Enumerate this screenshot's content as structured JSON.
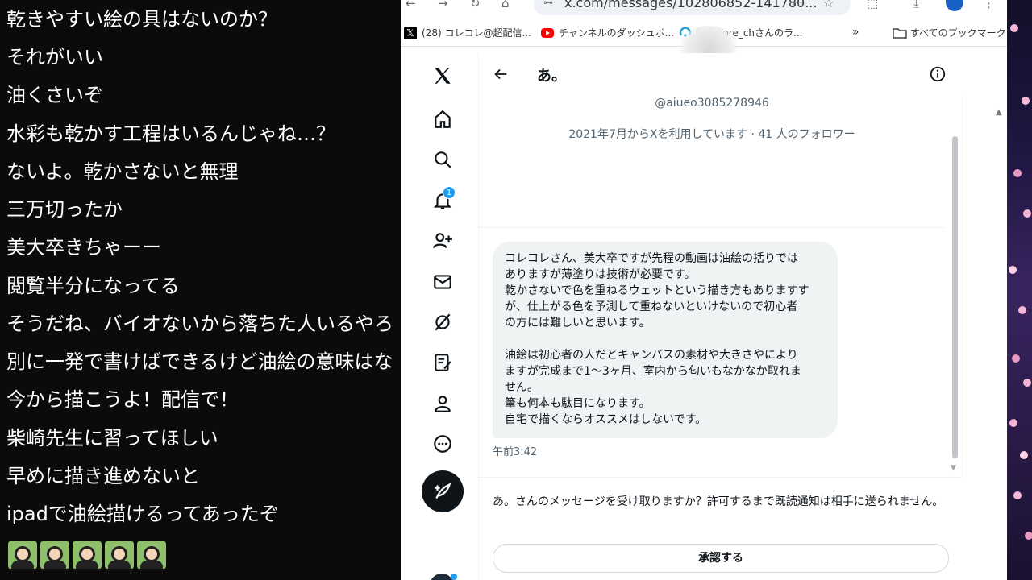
{
  "chat": {
    "lines": [
      "乾きやすい絵の具はないのか？",
      "それがいい",
      "油くさいぞ",
      "水彩も乾かす工程はいるんじゃね…？",
      "ないよ。乾かさないと無理",
      "三万切ったか",
      "美大卒きちゃーー",
      "閲覧半分になってる",
      "そうだね、バイオないから落ちた人いるやろ",
      "別に一発で書けばできるけど油絵の意味はな",
      "今から描こうよ！配信で！",
      "柴崎先生に習ってほしい",
      "早めに描き進めないと",
      "ipadで油絵描けるってあったぞ"
    ],
    "stamps": [
      "stamp-icon",
      "stamp-icon",
      "stamp-icon",
      "stamp-icon",
      "stamp-icon"
    ]
  },
  "browser": {
    "url": "x.com/messages/102806852-141780...",
    "bookmarks": [
      {
        "label": "(28) コレコレ@超配信...",
        "icon": "x-logo-icon"
      },
      {
        "label": "チャンネルのダッシュボ...",
        "icon": "youtube-icon"
      },
      {
        "label": "korekore_chさんのラ...",
        "icon": "radio-icon"
      }
    ],
    "all_bookmarks": "すべてのブックマーク",
    "more": "»"
  },
  "x": {
    "nav": [
      "x-logo-icon",
      "home-icon",
      "search-icon",
      "notifications-icon",
      "follow-icon",
      "messages-icon",
      "grok-icon",
      "lists-icon",
      "profile-icon",
      "more-icon"
    ],
    "notification_count": "1",
    "conversation": {
      "title": "あ。",
      "handle": "@aiueo3085278946",
      "joined": "2021年7月からXを利用しています · 41 人のフォロワー",
      "message_lines": [
        "コレコレさん、美大卒ですが先程の動画は油絵の括りでは",
        "ありますが薄塗りは技術が必要です。",
        "乾かさないで色を重ねるウェットという描き方もありますす",
        "が、仕上がる色を予測して重ねないといけないので初心者",
        "の方には難しいと思います。",
        "",
        "油絵は初心者の人だとキャンバスの素材や大きさやにより",
        "ますが完成まで1〜3ヶ月、室内から匂いもなかなか取れま",
        "せん。",
        "筆も何本も駄目になります。",
        "自宅で描くならオススメはしないです。"
      ],
      "time": "午前3:42",
      "request_text": "あ。さんのメッセージを受け取りますか？許可するまで既読通知は相手に送られません。",
      "accept_label": "承認する"
    }
  },
  "colors": {
    "accent": "#1d9bf0",
    "bubble": "#eff3f4",
    "text": "#0f1419",
    "muted": "#536471"
  }
}
